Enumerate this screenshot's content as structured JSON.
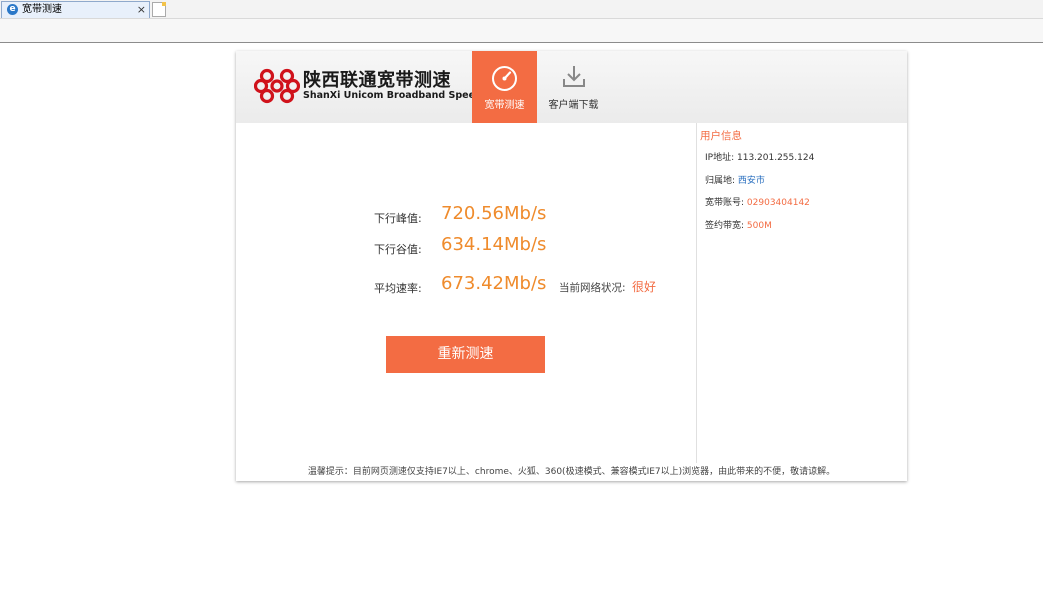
{
  "browser": {
    "tab_title": "宽带测速",
    "tab_close": "×"
  },
  "header": {
    "brand_cn": "陕西联通宽带测速",
    "brand_en": "ShanXi Unicom Broadband Speed",
    "nav": [
      {
        "label": "宽带测速",
        "icon": "speedometer-icon",
        "active": true
      },
      {
        "label": "客户端下载",
        "icon": "download-icon",
        "active": false
      }
    ]
  },
  "results": {
    "download_peak_label": "下行峰值:",
    "download_peak_value": "720.56Mb/s",
    "download_low_label": "下行谷值:",
    "download_low_value": "634.14Mb/s",
    "average_label": "平均速率:",
    "average_value": "673.42Mb/s",
    "network_status_label": "当前网络状况:",
    "network_status_value": "很好",
    "retest_label": "重新测速"
  },
  "user_info": {
    "title": "用户信息",
    "ip_label": "IP地址:",
    "ip_value": "113.201.255.124",
    "location_label": "归属地:",
    "location_value": "西安市",
    "account_label": "宽带账号:",
    "account_value": "02903404142",
    "bandwidth_label": "签约带宽:",
    "bandwidth_value": "500M"
  },
  "notice": "温馨提示：目前网页测速仅支持IE7以上、chrome、火狐、360(极速模式、兼容模式IE7以上)浏览器，由此带来的不便，敬请谅解。",
  "colors": {
    "accent": "#f36c43",
    "value_orange": "#ef8b2c",
    "link_blue": "#2a6fbf"
  }
}
